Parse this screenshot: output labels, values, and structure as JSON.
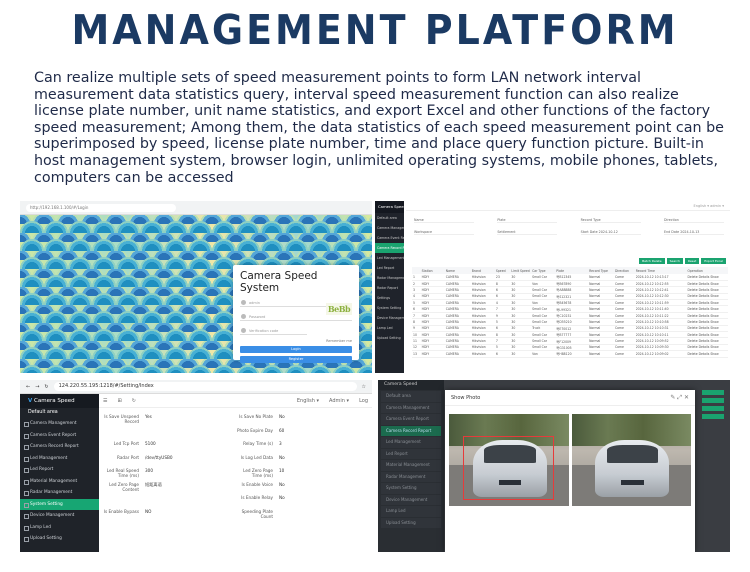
{
  "header": {
    "title": "MANAGEMENT PLATFORM",
    "description": "Can realize multiple sets of speed measurement points to form LAN network interval measurement data statistics query, interval speed measurement function can also realize license plate number, unit name statistics, and export Excel and other functions of the factory speed measurement; Among them, the data statistics of each speed measurement point can be superimposed by speed, license plate number, time and place query function picture. Built-in host management system, browser login, unlimited operating systems, mobile phones, tablets, computers can be accessed"
  },
  "login_panel": {
    "url": "http://192.168.1.100/#/Login",
    "box_title": "Camera Speed System",
    "username_placeholder": "admin",
    "password_placeholder": "Password",
    "captcha_placeholder": "Verification code",
    "captcha_text": "BeBb",
    "remember_label": "Remember me",
    "login_button": "Login",
    "register_button": "Register"
  },
  "table_panel": {
    "logo": "Camera Speed",
    "sidebar": [
      "Default area",
      "Camera Management",
      "Camera Event Report",
      "Camera Record Report",
      "Led Management",
      "Led Report",
      "Radar Management",
      "Radar Report",
      "Settings",
      "System Setting",
      "Device Management",
      "Lamp Led",
      "Upload Setting"
    ],
    "active_index": 3,
    "topbar": "English ▾   admin ▾",
    "filters_row1": [
      "Name",
      "Plate",
      "Record Type",
      "Direction"
    ],
    "filters_row2": [
      "Workspace",
      "Settlement",
      "Start Date  2024-10-12",
      "End Date  2024-10-13"
    ],
    "buttons": [
      "Batch Delete",
      "Search",
      "Reset",
      "Export Excel"
    ],
    "columns": [
      "",
      "Station",
      "Name",
      "Brand",
      "Speed",
      "Limit Speed",
      "Car Type",
      "Plate",
      "Record Type",
      "Direction",
      "Record Time",
      "Operation"
    ],
    "rows": [
      [
        "1",
        "HDIY",
        "CAMERA",
        "Hikvision",
        "23",
        "30",
        "Small Car",
        "粤B12345",
        "Normal",
        "Come",
        "2024-10-12 10:13:17",
        "Delete Details Show"
      ],
      [
        "2",
        "HDIY",
        "CAMERA",
        "Hikvision",
        "8",
        "30",
        "Van",
        "粤B67890",
        "Normal",
        "Come",
        "2024-10-12 10:12:55",
        "Delete Details Show"
      ],
      [
        "3",
        "HDIY",
        "CAMERA",
        "Hikvision",
        "6",
        "30",
        "Small Car",
        "粤A88888",
        "Normal",
        "Come",
        "2024-10-12 10:12:41",
        "Delete Details Show"
      ],
      [
        "4",
        "HDIY",
        "CAMERA",
        "Hikvision",
        "6",
        "30",
        "Small Car",
        "粤S12321",
        "Normal",
        "Come",
        "2024-10-12 10:12:30",
        "Delete Details Show"
      ],
      [
        "5",
        "HDIY",
        "CAMERA",
        "Hikvision",
        "4",
        "30",
        "Van",
        "粤B45678",
        "Normal",
        "Come",
        "2024-10-12 10:11:59",
        "Delete Details Show"
      ],
      [
        "6",
        "HDIY",
        "CAMERA",
        "Hikvision",
        "7",
        "30",
        "Small Car",
        "粤L99321",
        "Normal",
        "Come",
        "2024-10-12 10:11:40",
        "Delete Details Show"
      ],
      [
        "7",
        "HDIY",
        "CAMERA",
        "Hikvision",
        "9",
        "30",
        "Small Car",
        "粤C10231",
        "Normal",
        "Come",
        "2024-10-12 10:11:22",
        "Delete Details Show"
      ],
      [
        "8",
        "HDIY",
        "CAMERA",
        "Hikvision",
        "5",
        "30",
        "Small Car",
        "粤D55210",
        "Normal",
        "Come",
        "2024-10-12 10:10:58",
        "Delete Details Show"
      ],
      [
        "9",
        "HDIY",
        "CAMERA",
        "Hikvision",
        "6",
        "30",
        "Truck",
        "粤E70012",
        "Normal",
        "Come",
        "2024-10-12 10:10:31",
        "Delete Details Show"
      ],
      [
        "10",
        "HDIY",
        "CAMERA",
        "Hikvision",
        "8",
        "30",
        "Small Car",
        "粤B77777",
        "Normal",
        "Come",
        "2024-10-12 10:10:11",
        "Delete Details Show"
      ],
      [
        "11",
        "HDIY",
        "CAMERA",
        "Hikvision",
        "7",
        "30",
        "Small Car",
        "粤F12009",
        "Normal",
        "Come",
        "2024-10-12 10:09:52",
        "Delete Details Show"
      ],
      [
        "12",
        "HDIY",
        "CAMERA",
        "Hikvision",
        "5",
        "30",
        "Small Car",
        "粤G31005",
        "Normal",
        "Come",
        "2024-10-12 10:09:30",
        "Delete Details Show"
      ],
      [
        "13",
        "HDIY",
        "CAMERA",
        "Hikvision",
        "6",
        "30",
        "Van",
        "粤H88120",
        "Normal",
        "Come",
        "2024-10-12 10:09:02",
        "Delete Details Show"
      ]
    ]
  },
  "settings_panel": {
    "url": "124.220.55.195:1218/#/Setting/Index",
    "logo_prefix": "V",
    "logo": "Camera Speed",
    "area": "Default area",
    "topbar": [
      "English ▾",
      "Admin ▾",
      "Log"
    ],
    "sidebar": [
      "Camera Management",
      "Camera Event Report",
      "Camera Record Report",
      "Led Management",
      "Led Report",
      "Material Management",
      "Radar Management",
      "System Setting",
      "Device Management",
      "Lamp Led",
      "Upload Setting"
    ],
    "active_index": 7,
    "fields": [
      {
        "l1": "Is Save Unspeed Record",
        "v1": "Yes",
        "l2": "Is Save No Plate",
        "v2": "No"
      },
      {
        "l1": "",
        "v1": "",
        "l2": "Photo Expire Day",
        "v2": "60"
      },
      {
        "l1": "Led Tcp Port",
        "v1": "5100",
        "l2": "Relay Time (s)",
        "v2": "3"
      },
      {
        "l1": "Radar Port",
        "v1": "/dev/ttyUSB0",
        "l2": "Is Log Led Data",
        "v2": "No"
      },
      {
        "l1": "Led Real Speed Time (ms)",
        "v1": "300",
        "l2": "Led Zero Page Time (ms)",
        "v2": "10"
      },
      {
        "l1": "Led Zero Page Content",
        "v1": "短距离语",
        "l2": "Is Enable Voice",
        "v2": "No"
      },
      {
        "l1": "",
        "v1": "",
        "l2": "Is Enable Relay",
        "v2": "No"
      },
      {
        "l1": "Is Enable Bypass",
        "v1": "NO",
        "l2": "Speeding Plate Count",
        "v2": ""
      }
    ]
  },
  "photo_panel": {
    "logo": "Camera Speed",
    "sidebar": [
      "Default area",
      "Camera Management",
      "Camera Event Report",
      "Camera Record Report",
      "Led Management",
      "Led Report",
      "Material Management",
      "Radar Management",
      "System Setting",
      "Device Management",
      "Lamp Led",
      "Upload Setting"
    ],
    "active_index": 3,
    "modal_title": "Show Photo",
    "modal_controls": "✎  ⤢  ✕"
  },
  "colors": {
    "title": "#1b3a63",
    "accent_green": "#1aa36f",
    "accent_blue": "#3a8ee6",
    "sidebar_dark": "#1f2329"
  }
}
